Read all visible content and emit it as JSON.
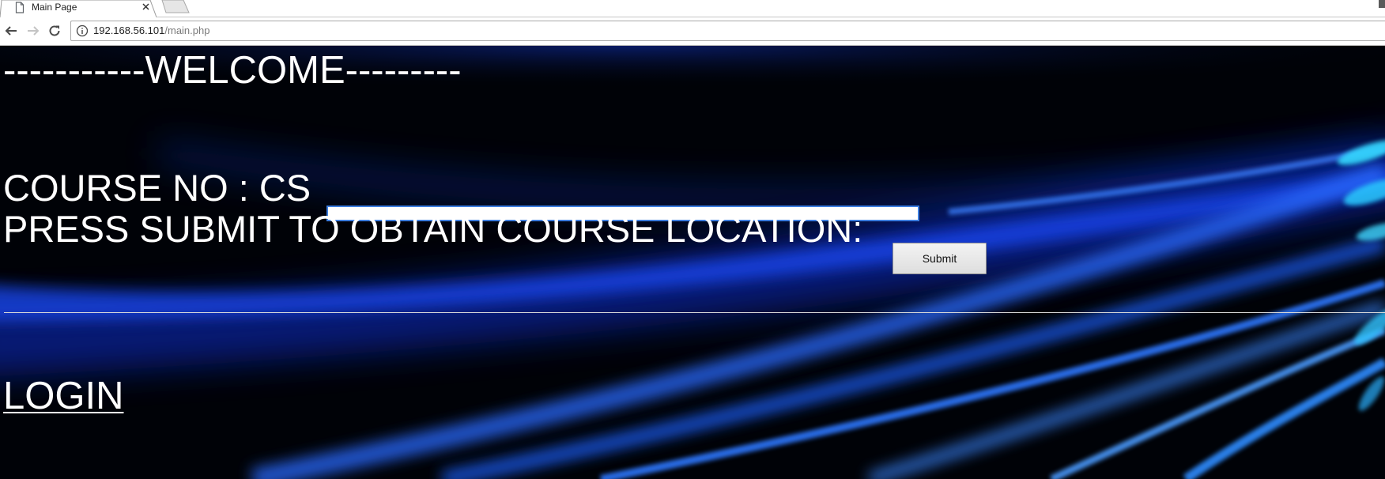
{
  "browser": {
    "tab": {
      "title": "Main Page"
    },
    "address_bar": {
      "host": "192.168.56.101",
      "path": "/main.php"
    }
  },
  "page": {
    "welcome_heading": "-----------WELCOME---------",
    "course_label": "COURSE NO : CS",
    "course_input": {
      "value": "",
      "placeholder": ""
    },
    "submit_prompt": "PRESS SUBMIT TO OBTAIN COURSE LOCATION:",
    "submit_button_label": "Submit",
    "login_link": "LOGIN"
  },
  "colors": {
    "page_background": "#000207",
    "light_streak": "#1a5cff",
    "text": "#ffffff",
    "input_focus_border": "#3d7ee0"
  },
  "icons": {
    "tab_favicon": "document-icon",
    "tab_close": "close-icon",
    "nav_back": "arrow-left-icon",
    "nav_forward": "arrow-right-icon",
    "nav_reload": "reload-icon",
    "site_info": "info-icon"
  }
}
